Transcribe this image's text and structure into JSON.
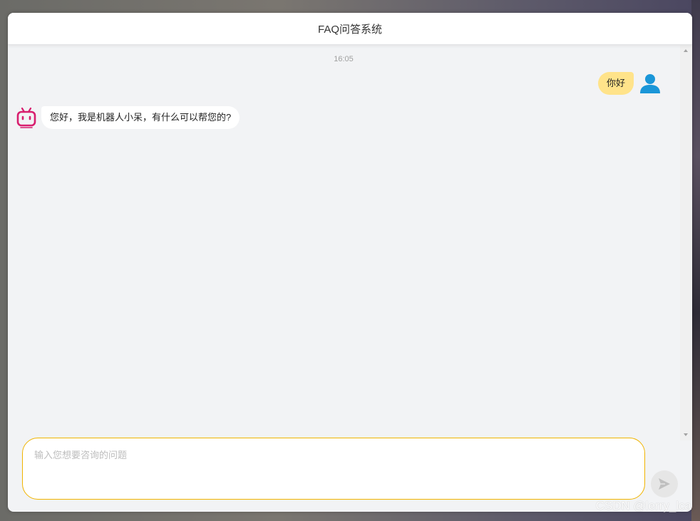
{
  "header": {
    "title": "FAQ问答系统"
  },
  "chat": {
    "timestamp": "16:05",
    "messages": [
      {
        "role": "user",
        "text": "你好",
        "avatar_icon": "user-icon"
      },
      {
        "role": "bot",
        "text": "您好，我是机器人小呆，有什么可以帮您的?",
        "avatar_icon": "robot-icon"
      }
    ]
  },
  "input": {
    "placeholder": "输入您想要咨询的问题",
    "value": ""
  },
  "send": {
    "icon": "send-icon"
  },
  "watermark": "CSDN @lerry_lca",
  "colors": {
    "user_bubble": "#ffe38a",
    "user_icon": "#1a96d8",
    "bot_icon": "#d81e6e",
    "input_border": "#f0b400"
  }
}
